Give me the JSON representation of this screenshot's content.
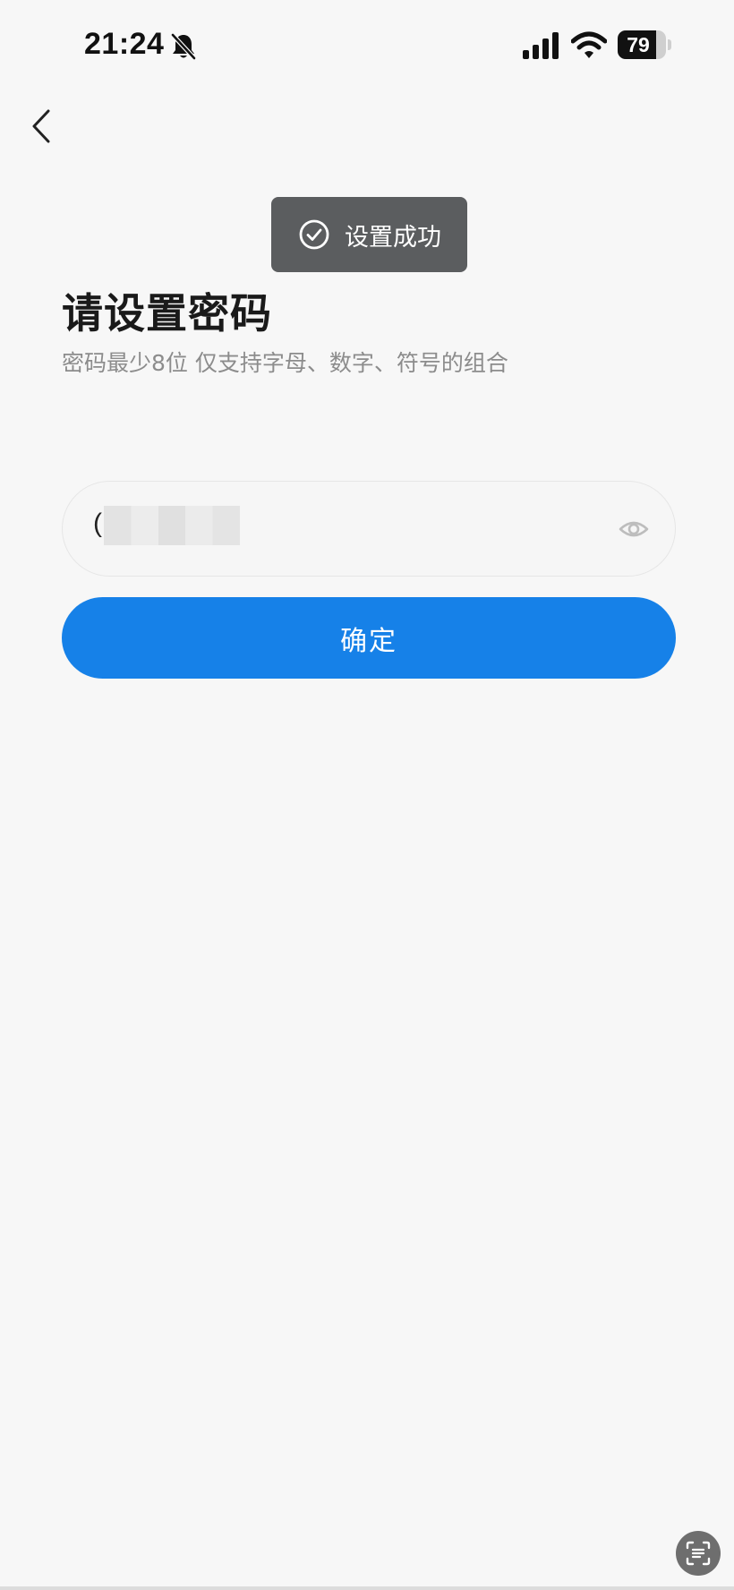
{
  "status_bar": {
    "time": "21:24",
    "battery_level": "79",
    "battery_fraction": 0.79,
    "icons": [
      "bell-slash-icon",
      "cellular-signal-icon",
      "wifi-icon",
      "battery-icon"
    ]
  },
  "nav": {
    "back_icon": "chevron-left-icon"
  },
  "toast": {
    "icon": "check-circle-icon",
    "text": "设置成功"
  },
  "page": {
    "title": "请设置密码",
    "subtitle": "密码最少8位 仅支持字母、数字、符号的组合"
  },
  "password_field": {
    "value_visible": "(",
    "visibility_icon": "eye-icon"
  },
  "confirm_button": {
    "label": "确定",
    "color": "#1681e8"
  },
  "floating_button": {
    "icon": "scan-text-icon"
  },
  "colors": {
    "background": "#f7f7f7",
    "toast_bg": "#5b5d5f",
    "subtitle": "#8c8c8c"
  }
}
